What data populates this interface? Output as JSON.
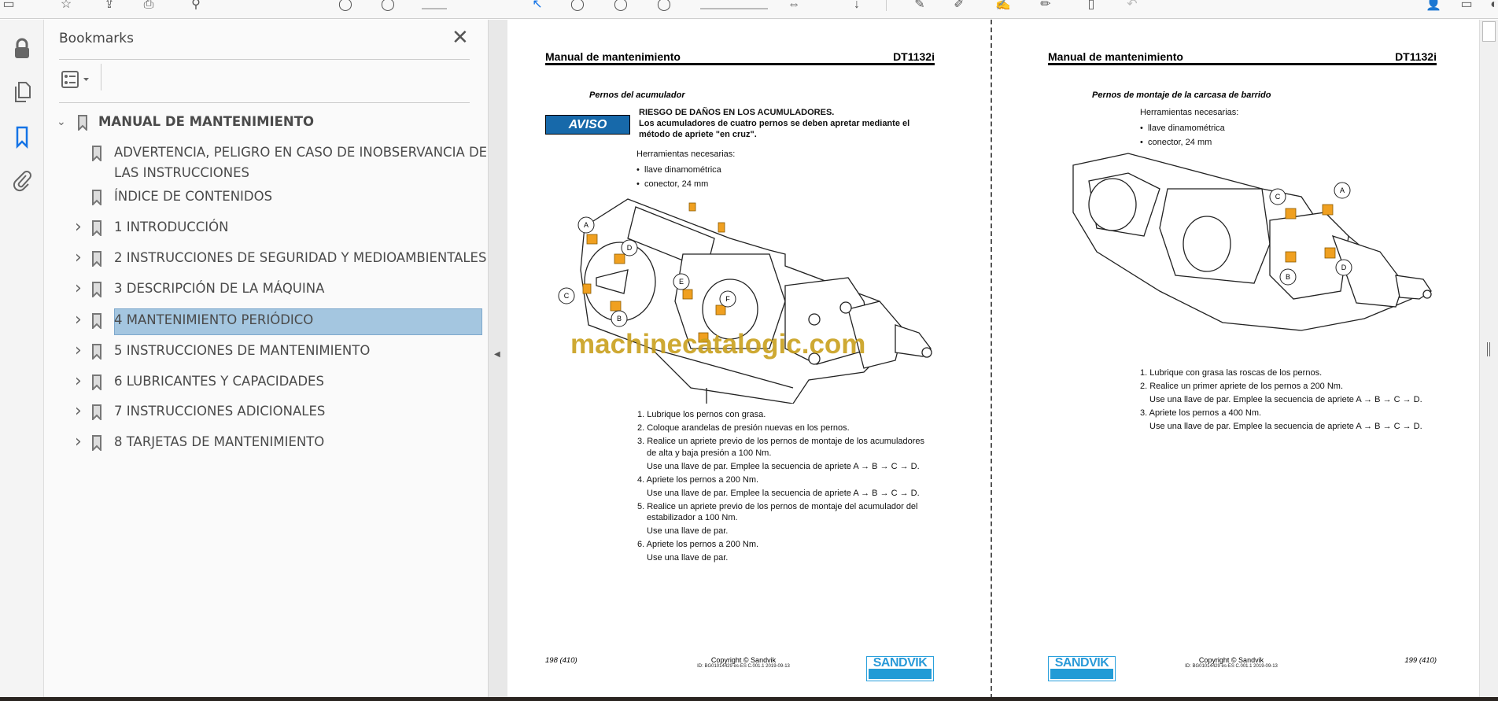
{
  "sidebar": {
    "title": "Bookmarks",
    "close_icon": "close-icon",
    "items": [
      {
        "label": "MANUAL DE MANTENIMIENTO",
        "expanded": true,
        "level": 0
      },
      {
        "label": "ADVERTENCIA, PELIGRO EN CASO DE INOBSERVANCIA DE",
        "label2": "LAS INSTRUCCIONES",
        "level": 1
      },
      {
        "label": "ÍNDICE DE CONTENIDOS",
        "level": 1
      },
      {
        "label": "1 INTRODUCCIÓN",
        "level": 1
      },
      {
        "label": "2 INSTRUCCIONES DE SEGURIDAD Y MEDIOAMBIENTALES",
        "level": 1
      },
      {
        "label": "3 DESCRIPCIÓN DE LA MÁQUINA",
        "level": 1
      },
      {
        "label": "4 MANTENIMIENTO PERIÓDICO",
        "level": 1,
        "selected": true
      },
      {
        "label": "5 INSTRUCCIONES DE MANTENIMIENTO",
        "level": 1
      },
      {
        "label": "6 LUBRICANTES Y CAPACIDADES",
        "level": 1
      },
      {
        "label": "7 INSTRUCCIONES ADICIONALES",
        "level": 1
      },
      {
        "label": "8 TARJETAS DE MANTENIMIENTO",
        "level": 1
      }
    ],
    "selected_color": "#a4c6e0"
  },
  "rail": {
    "icons": [
      "lock-icon",
      "pages-icon",
      "bookmark-icon",
      "attachment-icon"
    ],
    "active": "bookmark-icon",
    "active_color": "#1473e6"
  },
  "left_page": {
    "header_title": "Manual de mantenimiento",
    "header_model": "DT1132i",
    "section": "Pernos del acumulador",
    "notice_label": "AVISO",
    "notice_title": "RIESGO DE DAÑOS EN LOS ACUMULADORES.",
    "notice_line1": "Los acumuladores de cuatro pernos se deben apretar mediante el",
    "notice_line2": "método de apriete \"en cruz\".",
    "tools_label": "Herramientas necesarias:",
    "tools": [
      "llave dinamométrica",
      "conector, 24 mm"
    ],
    "figure_labels": [
      "A",
      "B",
      "C",
      "D",
      "E",
      "F"
    ],
    "steps": [
      "1. Lubrique los pernos con grasa.",
      "2. Coloque arandelas de presión nuevas en los pernos.",
      "3. Realice un apriete previo de los pernos de montaje de los acumuladores",
      "de alta y baja presión a 100 Nm.",
      "Use una llave de par. Emplee la secuencia de apriete A → B → C → D.",
      "4. Apriete los pernos a 200 Nm.",
      "Use una llave de par. Emplee la secuencia de apriete A → B → C → D.",
      "5. Realice un apriete previo de los pernos de montaje del acumulador del",
      "estabilizador a 100 Nm.",
      "Use una llave de par.",
      "6. Apriete los pernos a 200 Nm.",
      "Use una llave de par."
    ],
    "page_number": "198 (410)",
    "copyright": "Copyright © Sandvik",
    "doc_id": "ID: BG01014429 es-ES C.001.1 2019-09-13",
    "logo": "SANDVIK"
  },
  "right_page": {
    "header_title": "Manual de mantenimiento",
    "header_model": "DT1132i",
    "section": "Pernos de montaje de la carcasa de barrido",
    "tools_label": "Herramientas necesarias:",
    "tools": [
      "llave dinamométrica",
      "conector, 24 mm"
    ],
    "figure_labels": [
      "A",
      "B",
      "C",
      "D"
    ],
    "steps": [
      "1. Lubrique con grasa las roscas de los pernos.",
      "2. Realice un primer apriete de los pernos a 200 Nm.",
      "Use una llave de par. Emplee la secuencia de apriete A → B → C → D.",
      "3. Apriete los pernos a 400 Nm.",
      "Use una llave de par. Emplee la secuencia de apriete A → B → C → D."
    ],
    "page_number": "199 (410)",
    "copyright": "Copyright © Sandvik",
    "doc_id": "ID: BG01014429 es-ES C.001.1 2019-09-13",
    "logo": "SANDVIK"
  },
  "watermark": "machinecatalogic.com",
  "colors": {
    "aviso": "#1769aa",
    "sandvik": "#229bd6",
    "bolt": "#f0a020",
    "watermark": "#c9a01e"
  }
}
